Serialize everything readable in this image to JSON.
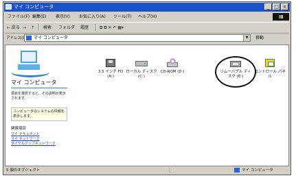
{
  "window": {
    "title": "マイ コンピュータ",
    "controls": {
      "minimize": "_",
      "maximize": "□",
      "close": "×"
    }
  },
  "menubar": {
    "items": [
      "ファイル(F)",
      "編集(E)",
      "表示(V)",
      "お気に入り(A)",
      "ツール(T)",
      "ヘルプ(H)"
    ]
  },
  "toolbar": {
    "back": "← 戻る",
    "forward": "→",
    "up": "↑",
    "search": "検索",
    "folders": "フォルダ",
    "history": "履歴",
    "extra": "⧉ ⧉ ✕ ↶ ▦▾"
  },
  "address": {
    "label": "アドレス(D)",
    "value": "マイ コンピュータ",
    "go": "移動"
  },
  "pane": {
    "title": "マイ コンピュータ",
    "description": "項目を選択すると、その説明が表示されます。",
    "tip": "コンピュータのシステムの情報を表示します。",
    "see_also_label": "関連項目",
    "links": [
      "マイ ドキュメント",
      "マイ ネットワーク",
      "ダイヤルアップネットワーク"
    ]
  },
  "drives": [
    {
      "name": "3.5 インチ FD (A:)",
      "icon": "floppy-drive-icon"
    },
    {
      "name": "ローカル ディスク (C:)",
      "icon": "hard-disk-icon"
    },
    {
      "name": "CD-ROM (D:)",
      "icon": "cd-drive-icon"
    },
    {
      "name": "リムーバブル ディスク (E:)",
      "icon": "removable-disk-icon",
      "highlighted": true
    },
    {
      "name": "コントロール パネル",
      "icon": "control-panel-icon"
    }
  ],
  "status": {
    "left": "5 個のオブジェクト",
    "right": "マイ コンピュータ"
  },
  "colors": {
    "titlebar": "#1c52c7",
    "link": "#1a3fd0",
    "window_face": "#d4d0c8"
  }
}
